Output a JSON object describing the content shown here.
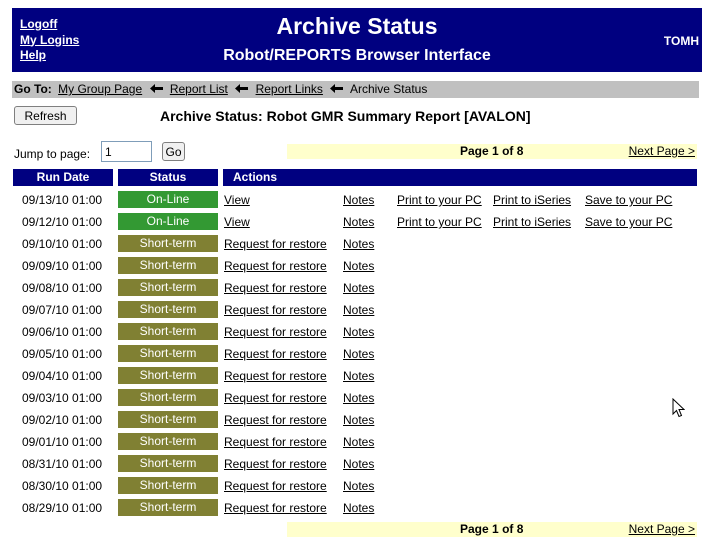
{
  "header": {
    "links": [
      "Logoff",
      "My Logins",
      "Help"
    ],
    "title": "Archive Status",
    "subtitle": "Robot/REPORTS Browser Interface",
    "user": "TOMH"
  },
  "breadcrumb": {
    "label": "Go To:",
    "links": [
      "My Group Page",
      "Report List",
      "Report Links"
    ],
    "current": "Archive Status"
  },
  "toolbar": {
    "refresh_label": "Refresh",
    "report_title": "Archive Status: Robot GMR Summary Report [AVALON]"
  },
  "paging": {
    "jump_label": "Jump to page:",
    "page_value": "1",
    "go_label": "Go",
    "page_word": "Page",
    "current_page": "1",
    "of_word": "of",
    "total_pages": "8",
    "next_label": "Next Page >"
  },
  "table": {
    "headers": {
      "run_date": "Run Date",
      "status": "Status",
      "actions": "Actions"
    },
    "rows": [
      {
        "date": "09/13/10 01:00",
        "status": "On-Line",
        "kind": "online",
        "action": "View",
        "notes": "Notes",
        "print_pc": "Print to your PC",
        "print_iseries": "Print to iSeries",
        "save_pc": "Save to your PC"
      },
      {
        "date": "09/12/10 01:00",
        "status": "On-Line",
        "kind": "online",
        "action": "View",
        "notes": "Notes",
        "print_pc": "Print to your PC",
        "print_iseries": "Print to iSeries",
        "save_pc": "Save to your PC"
      },
      {
        "date": "09/10/10 01:00",
        "status": "Short-term",
        "kind": "short",
        "action": "Request for restore",
        "notes": "Notes"
      },
      {
        "date": "09/09/10 01:00",
        "status": "Short-term",
        "kind": "short",
        "action": "Request for restore",
        "notes": "Notes"
      },
      {
        "date": "09/08/10 01:00",
        "status": "Short-term",
        "kind": "short",
        "action": "Request for restore",
        "notes": "Notes"
      },
      {
        "date": "09/07/10 01:00",
        "status": "Short-term",
        "kind": "short",
        "action": "Request for restore",
        "notes": "Notes"
      },
      {
        "date": "09/06/10 01:00",
        "status": "Short-term",
        "kind": "short",
        "action": "Request for restore",
        "notes": "Notes"
      },
      {
        "date": "09/05/10 01:00",
        "status": "Short-term",
        "kind": "short",
        "action": "Request for restore",
        "notes": "Notes"
      },
      {
        "date": "09/04/10 01:00",
        "status": "Short-term",
        "kind": "short",
        "action": "Request for restore",
        "notes": "Notes"
      },
      {
        "date": "09/03/10 01:00",
        "status": "Short-term",
        "kind": "short",
        "action": "Request for restore",
        "notes": "Notes"
      },
      {
        "date": "09/02/10 01:00",
        "status": "Short-term",
        "kind": "short",
        "action": "Request for restore",
        "notes": "Notes"
      },
      {
        "date": "09/01/10 01:00",
        "status": "Short-term",
        "kind": "short",
        "action": "Request for restore",
        "notes": "Notes"
      },
      {
        "date": "08/31/10 01:00",
        "status": "Short-term",
        "kind": "short",
        "action": "Request for restore",
        "notes": "Notes"
      },
      {
        "date": "08/30/10 01:00",
        "status": "Short-term",
        "kind": "short",
        "action": "Request for restore",
        "notes": "Notes"
      },
      {
        "date": "08/29/10 01:00",
        "status": "Short-term",
        "kind": "short",
        "action": "Request for restore",
        "notes": "Notes"
      }
    ]
  },
  "colors": {
    "header_bg": "#000080",
    "online": "#339933",
    "short_term": "#808033",
    "page_bar": "#ffffcc",
    "breadcrumb_bg": "#c0c0c0"
  },
  "icons": {
    "breadcrumb_separator": "left-arrow-icon",
    "cursor": "mouse-pointer-icon"
  }
}
